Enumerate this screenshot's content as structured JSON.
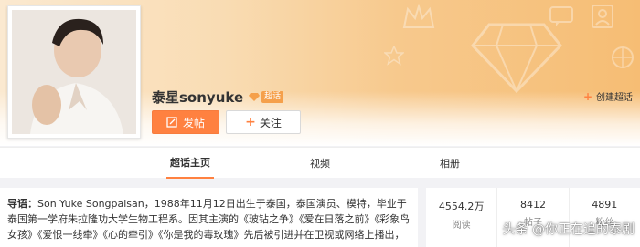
{
  "header": {
    "title": "泰星sonyuke",
    "badge_label": "超话",
    "create_link": "创建超话"
  },
  "actions": {
    "post_label": "发帖",
    "follow_label": "关注"
  },
  "tabs": [
    {
      "label": "超话主页",
      "active": true
    },
    {
      "label": "视频",
      "active": false
    },
    {
      "label": "相册",
      "active": false
    }
  ],
  "intro": {
    "lead": "导语：",
    "text": "Son Yuke Songpaisan，1988年11月12日出生于泰国，泰国演员、模特，毕业于泰国第一学府朱拉隆功大学生物工程系。因其主演的《玻钻之争》《爱在日落之前》《彩象鸟女孩》《爱恨一线牵》《心的牵引》《你是我的毒玫瑰》先后被引进并在卫视或网络上播出，"
  },
  "stats": [
    {
      "value": "4554.2万",
      "label": "阅读"
    },
    {
      "value": "8412",
      "label": "帖子"
    },
    {
      "value": "4891",
      "label": "粉丝"
    }
  ],
  "watermark": "头条 @你正在追的泰剧",
  "colors": {
    "accent": "#ff8140",
    "banner_start": "#fbe9d0",
    "banner_end": "#f6bd74"
  }
}
